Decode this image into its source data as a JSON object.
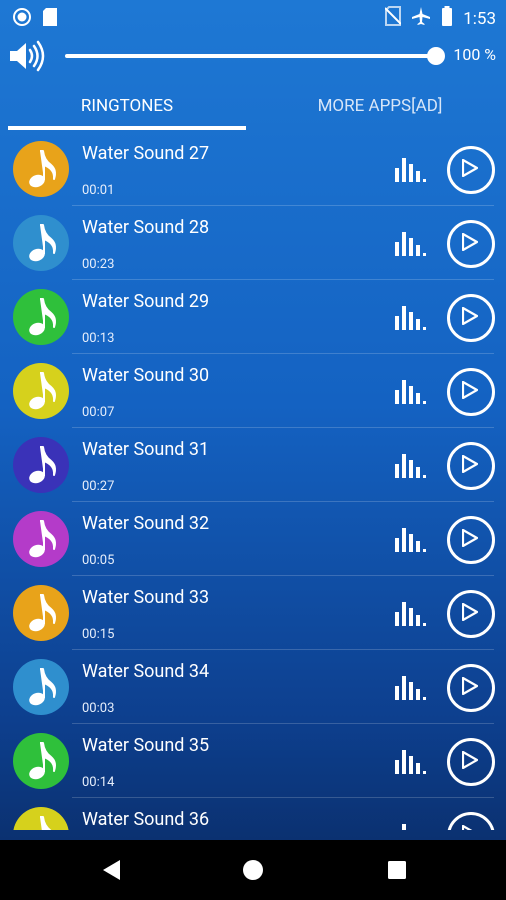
{
  "status_bar": {
    "time": "1:53"
  },
  "volume": {
    "percent_label": "100 %",
    "level_percent": 100
  },
  "tabs": [
    {
      "label": "RINGTONES",
      "selected": true
    },
    {
      "label": "MORE APPS[AD]",
      "selected": false
    }
  ],
  "ringtones": [
    {
      "title": "Water Sound 27",
      "duration": "00:01",
      "color": "#e8a31a"
    },
    {
      "title": "Water Sound 28",
      "duration": "00:23",
      "color": "#2f8fce"
    },
    {
      "title": "Water Sound 29",
      "duration": "00:13",
      "color": "#2fc03b"
    },
    {
      "title": "Water Sound 30",
      "duration": "00:07",
      "color": "#d6d11c"
    },
    {
      "title": "Water Sound 31",
      "duration": "00:27",
      "color": "#3a32b8"
    },
    {
      "title": "Water Sound 32",
      "duration": "00:05",
      "color": "#b43bc9"
    },
    {
      "title": "Water Sound 33",
      "duration": "00:15",
      "color": "#e8a31a"
    },
    {
      "title": "Water Sound 34",
      "duration": "00:03",
      "color": "#2f8fce"
    },
    {
      "title": "Water Sound 35",
      "duration": "00:14",
      "color": "#2fc03b"
    },
    {
      "title": "Water Sound 36",
      "duration": "",
      "color": "#d6d11c"
    }
  ],
  "icons": {
    "status_left": [
      "circle-notification-icon",
      "sd-card-icon"
    ],
    "status_right": [
      "no-sim-icon",
      "airplane-icon",
      "battery-icon"
    ],
    "volume": "speaker-icon",
    "row_icons": [
      "music-note-icon",
      "equalizer-icon",
      "play-icon"
    ],
    "nav": [
      "back-icon",
      "home-icon",
      "recents-icon"
    ]
  }
}
